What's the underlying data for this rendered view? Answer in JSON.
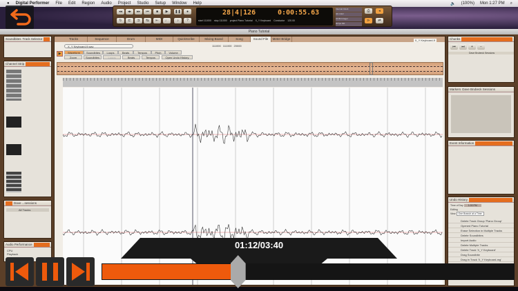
{
  "menubar": {
    "app": "Digital Performer",
    "items": [
      "File",
      "Edit",
      "Region",
      "Audio",
      "Project",
      "Studio",
      "Setup",
      "Window",
      "Help"
    ],
    "battery": "(100%)",
    "clock": "Mon 1:27 PM"
  },
  "transport": {
    "measure_counter": "28|4|126",
    "time_counter": "0:00:55.63",
    "start": "start 111000",
    "stop": "stop 111000",
    "project": "project Piano Tutorial",
    "track": "X_Y Keyboard",
    "conductor": "Conductor",
    "tempo": "120.00",
    "clock_source": "Internal Clock",
    "sample_rate": "44.1 kHz",
    "bit_depth": "24 Bit Integer",
    "format": "30 fps ND"
  },
  "window_title": "Piano Tutorial",
  "left": {
    "soundbites_tab": "Soundbites",
    "track_selector_tab": "Track Selector",
    "channel_strip": "Channel Strip",
    "tracks_header": "Dave ...sessions",
    "tracks_item": "All Tracks",
    "audio_perf": "Audio Performance",
    "cpu": "CPU",
    "playback": "Playback"
  },
  "tabs": [
    "Tracks",
    "Sequence",
    "Drum",
    "MIDI",
    "QuickScribe",
    "Mixing Board",
    "Song",
    "Sound File",
    "Meter Bridge"
  ],
  "editor": {
    "soundbite_name": "X_Y Keyboard-9.wav",
    "track_menu": "X_Y Keyboard-9",
    "sub_tabs": [
      "Waveform",
      "Soundbites",
      "Loops",
      "Beats",
      "Tempos",
      "Pitch",
      "Volume"
    ],
    "menus": [
      "Zoom",
      "Soundbites",
      "Loops",
      "Beats",
      "Tempos"
    ],
    "undo_button": "Open Undo History",
    "fields": [
      "111000",
      "111000",
      "20000"
    ]
  },
  "chunks": {
    "title": "Chunks",
    "row": "Dave Brubeck Sessions"
  },
  "markers": {
    "title": "Markers",
    "project": "Dave Brubeck Sessions"
  },
  "event_info": {
    "title": "Event Information"
  },
  "undo": {
    "title": "Undo History",
    "time_of_day": "Time of Day",
    "time": "1:00 PM",
    "editing": "Editing",
    "view": "View",
    "view_value": "One Branch at a Time",
    "items": [
      "Delete Track Group 'Piano Group'",
      "Opened Piano Tutorial",
      "Erase Selection in Multiple Tracks",
      "Delete Soundbites",
      "Import Audio",
      "Delete Multiple Tracks",
      "Delete Track 'X_Y Keyboard'",
      "Drag Soundbite",
      "Drag in Track 'X_Y Keyboard-mg'",
      "Delete Soundbites"
    ]
  },
  "player": {
    "time": "01:12/03:40",
    "progress": 0.33
  },
  "colors": {
    "accent": "#ee5a0c",
    "panel_bg": "#5b3f28"
  }
}
